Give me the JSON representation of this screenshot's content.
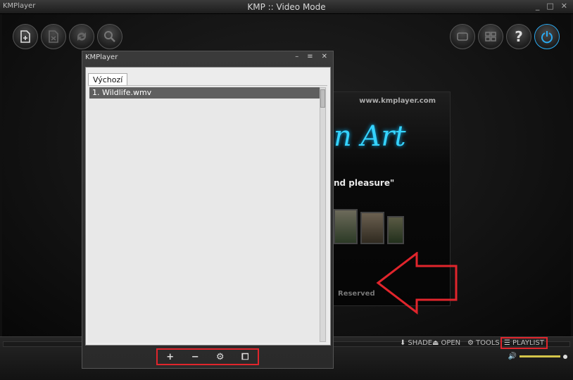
{
  "window": {
    "logo_text": "KMPlayer",
    "title": "KMP :: Video Mode",
    "controls": [
      "_",
      "□",
      "✕"
    ]
  },
  "top_controls": {
    "left": [
      "add-file-icon",
      "remove-file-icon",
      "refresh-icon",
      "search-icon"
    ],
    "right": [
      "screen-icon",
      "grid-icon",
      "help-icon",
      "power-icon"
    ],
    "help_label": "?"
  },
  "splash": {
    "url": "www.kmplayer.com",
    "art_text": "n Art",
    "tagline": "nd pleasure\"",
    "reserved": "Reserved"
  },
  "bottom_toolbar": {
    "shade": "SHADE",
    "open": "OPEN",
    "tools": "TOOLS",
    "playlist": "PLAYLIST"
  },
  "playlist_window": {
    "title": "KMPlayer",
    "tab": "Výchozí",
    "items": [
      "1. Wildlife.wmv"
    ],
    "tools": [
      "+",
      "−",
      "⚙",
      "⧠"
    ]
  },
  "colors": {
    "highlight": "#e0252c",
    "accent_blue": "#2aa9f0",
    "volume": "#d4c54a"
  }
}
